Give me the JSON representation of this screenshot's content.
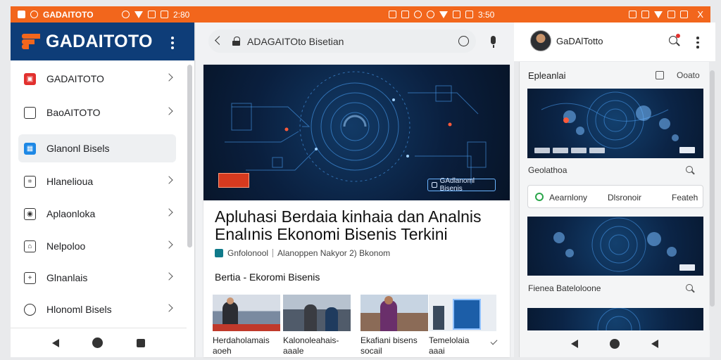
{
  "status_bar": {
    "app_name": "GADAITOTO",
    "time": "2:80",
    "center_time": "3:50",
    "close_label": "X"
  },
  "left_panel": {
    "brand": "GADAITOTO",
    "items": [
      {
        "label": "GADAITOTO",
        "icon": "brand-icon"
      },
      {
        "label": "BaoAITOTO",
        "icon": "chat-bubble-icon"
      },
      {
        "label": "Glanonl Bisels",
        "icon": "grid-icon"
      },
      {
        "label": "Hlanelioua",
        "icon": "clipboard-icon"
      },
      {
        "label": "Aplaonloka",
        "icon": "camera-icon"
      },
      {
        "label": "Nelpoloo",
        "icon": "bank-icon"
      },
      {
        "label": "Glnanlais",
        "icon": "plus-box-icon"
      },
      {
        "label": "Hlonoml Bisels",
        "icon": "shield-icon"
      }
    ]
  },
  "browser": {
    "address": "ADAGAITOto Bisetian"
  },
  "article": {
    "hero_badge": "GAdlanoml Bisenis",
    "headline_line1": "Apluhasi Berdaia  kinhaia dan Analnis",
    "headline_line2": "Enalınis Ekonomi Bisenis Terkini",
    "meta_tag": "Gnfolonool",
    "meta_author": "Alanoppen  Nakyor 2) Bkonom",
    "section_title": "Bertia - Ekoromi Bisenis",
    "thumbs": [
      {
        "caption_1": "Herdaholamais",
        "caption_2": "aoeh"
      },
      {
        "caption_1": "Kalonoleahais-",
        "caption_2": "aaale"
      },
      {
        "caption_1": "Ekafiani bisens",
        "caption_2": "socail"
      },
      {
        "caption_1": "Temelolaia",
        "caption_2": "aaai"
      }
    ]
  },
  "profile": {
    "name": "GaDAlTotto"
  },
  "right_panel": {
    "heading": "Epleanlai",
    "heading_right": "Ooato",
    "label_1": "Geolathoa",
    "pill_1": "Aearnlony",
    "pill_2": "Dlsronoir",
    "pill_3": "Feateh",
    "label_2": "Fienea Bateloloone"
  },
  "colors": {
    "status_bar": "#f2661c",
    "brand_header": "#0e3d78",
    "accent": "#f2661c"
  }
}
